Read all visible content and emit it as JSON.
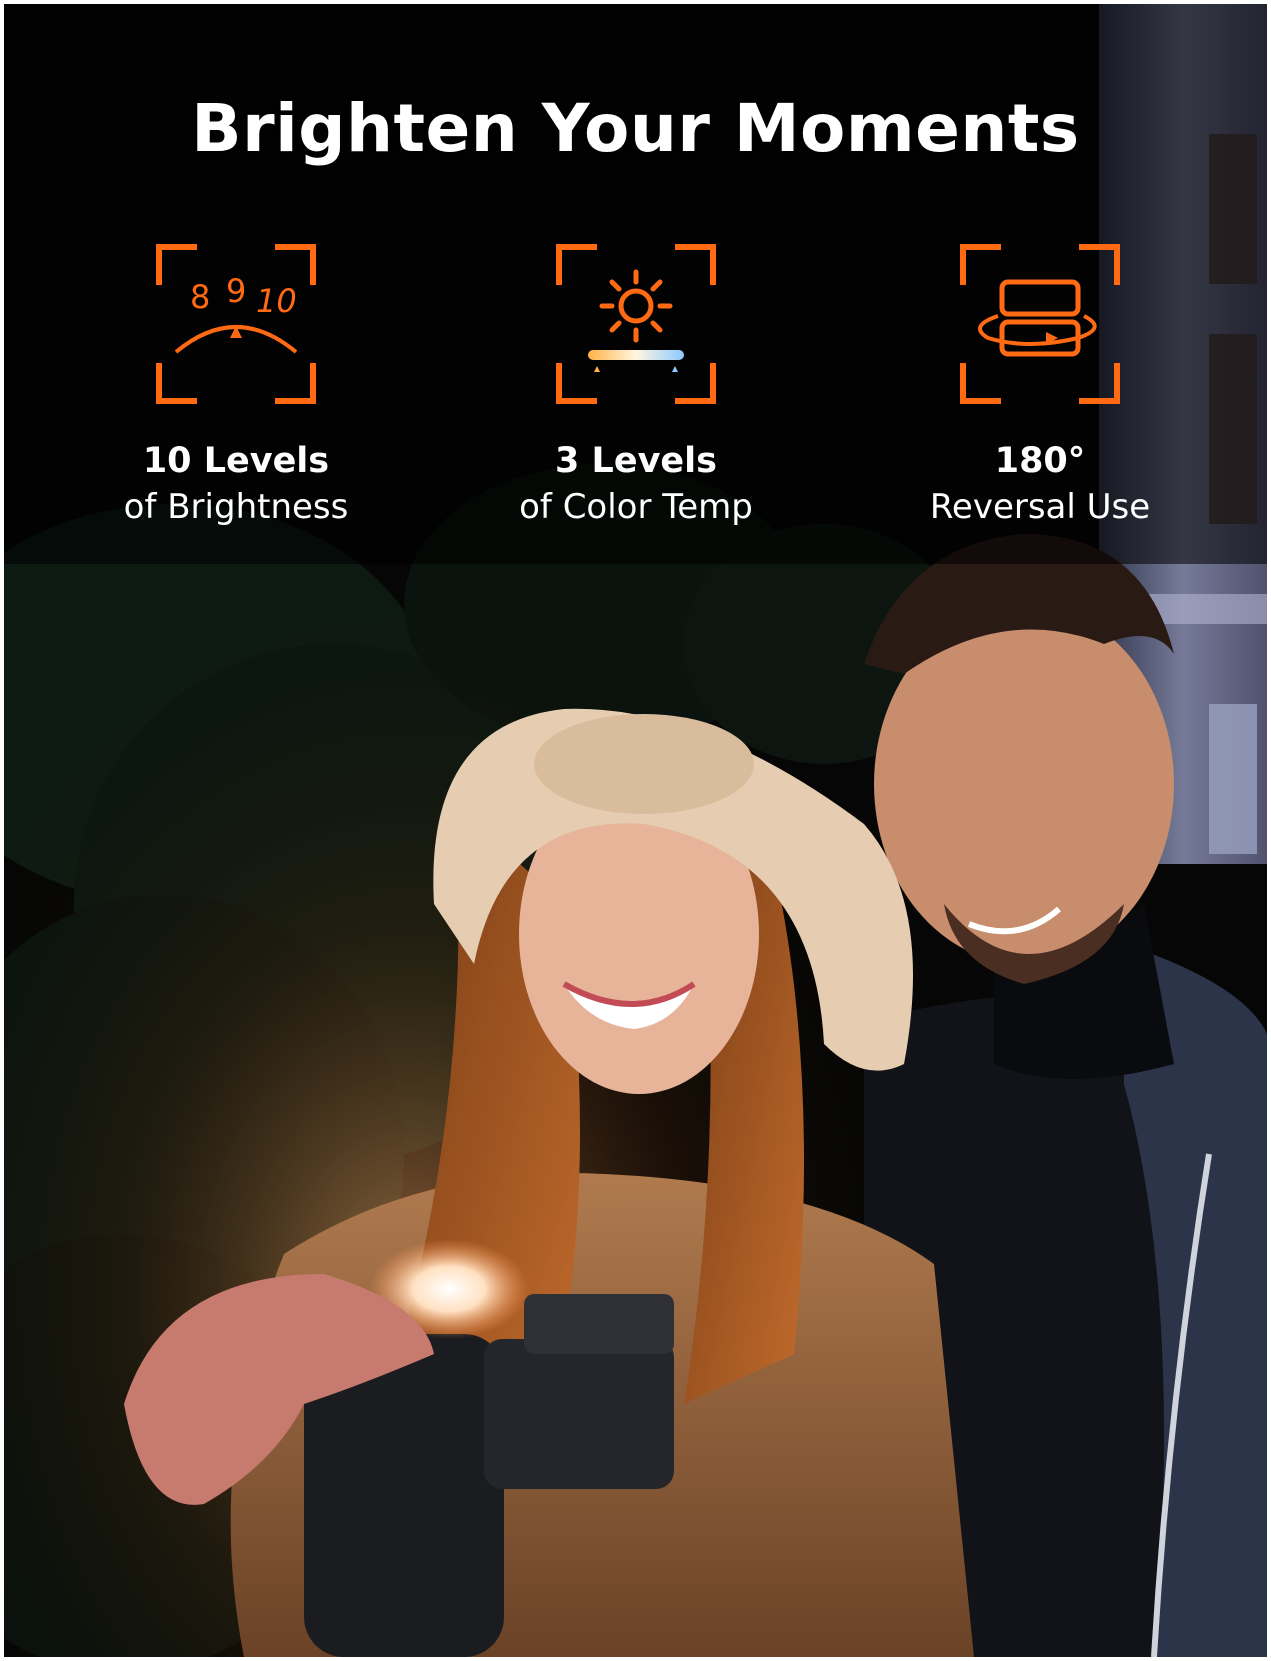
{
  "headline": "Brighten Your Moments",
  "accent_color": "#FF6A13",
  "features": [
    {
      "icon": "brightness-dial-icon",
      "icon_digits": [
        "8",
        "9",
        "10"
      ],
      "primary": "10 Levels",
      "secondary": "of Brightness"
    },
    {
      "icon": "color-temperature-sun-icon",
      "primary": "3 Levels",
      "secondary": "of Color Temp"
    },
    {
      "icon": "rotate-180-light-icon",
      "primary": "180°",
      "secondary": "Reversal Use"
    }
  ],
  "photo": {
    "content": "couple-taking-selfie-at-night-with-phone-fill-light"
  }
}
